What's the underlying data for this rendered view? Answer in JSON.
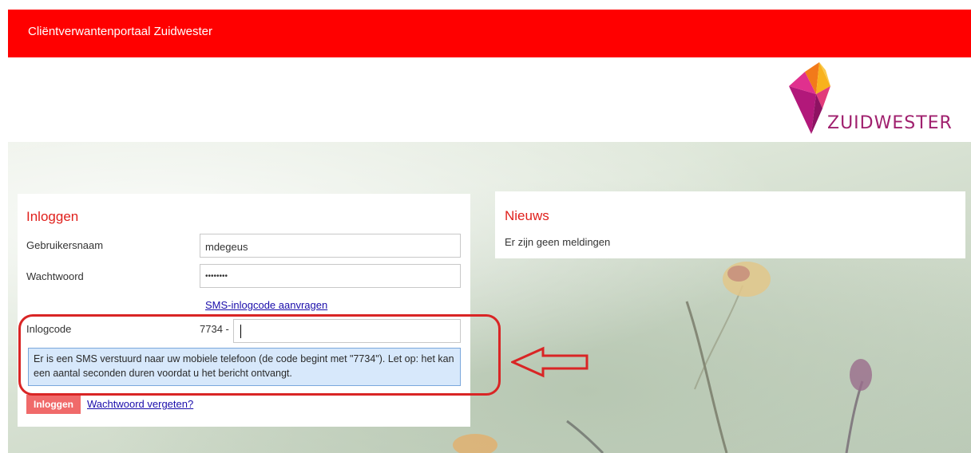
{
  "header": {
    "title": "Cliëntverwantenportaal Zuidwester"
  },
  "logo": {
    "text": "ZUIDWESTER"
  },
  "login": {
    "heading": "Inloggen",
    "username_label": "Gebruikersnaam",
    "username_value": "mdegeus",
    "password_label": "Wachtwoord",
    "password_value": "••••••••",
    "sms_link": "SMS-inlogcode aanvragen",
    "code_label": "Inlogcode",
    "code_prefix": "7734 -",
    "code_value": "",
    "info_message": "Er is een SMS verstuurd naar uw mobiele telefoon (de code begint met \"7734\"). Let op: het kan een aantal seconden duren voordat u het bericht ontvangt.",
    "login_button": "Inloggen",
    "forgot_link": "Wachtwoord vergeten?"
  },
  "news": {
    "heading": "Nieuws",
    "empty_text": "Er zijn geen meldingen"
  },
  "colors": {
    "header_bg": "#ff0000",
    "heading_red": "#e0201c",
    "info_bg": "#d7e8fb",
    "annotation_red": "#d92525"
  }
}
